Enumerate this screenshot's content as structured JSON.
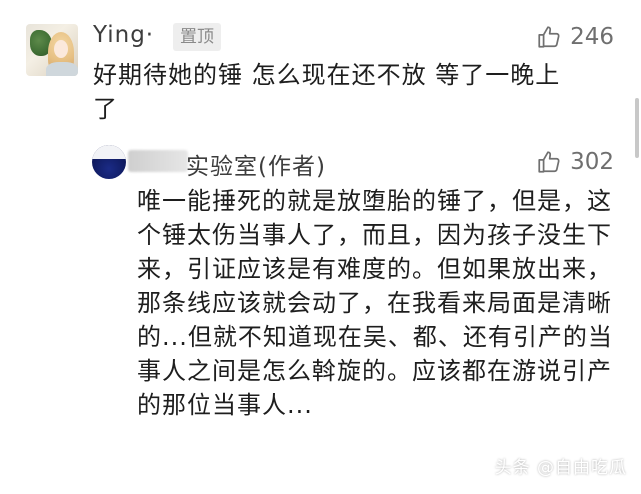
{
  "comment": {
    "username": "Ying",
    "dot": "·",
    "badge": "置顶",
    "likes": "246",
    "text": "好期待她的锤 怎么现在还不放 等了一晚上了"
  },
  "reply": {
    "username": "实验室(作者)",
    "likes": "302",
    "text": "唯一能捶死的就是放堕胎的锤了，但是，这个锤太伤当事人了，而且，因为孩子没生下来，引证应该是有难度的。但如果放出来，那条线应该就会动了，在我看来局面是清晰的...但就不知道现在吴、都、还有引产的当事人之间是怎么斡旋的。应该都在游说引产的那位当事人..."
  },
  "watermark": "头条 @自由吃瓜",
  "icons": {
    "like": "thumbs-up-icon"
  }
}
